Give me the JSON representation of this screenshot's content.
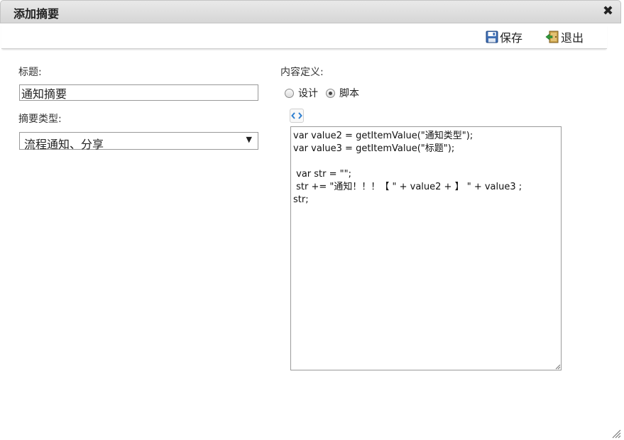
{
  "dialog": {
    "title": "添加摘要",
    "close_glyph": "✖"
  },
  "toolbar": {
    "save_label": "保存",
    "exit_label": "退出"
  },
  "form": {
    "title_label": "标题:",
    "title_value": "通知摘要",
    "summary_type_label": "摘要类型:",
    "summary_type_value": "流程通知、分享",
    "content_label": "内容定义:",
    "mode_options": [
      {
        "label": "设计",
        "checked": false
      },
      {
        "label": "脚本",
        "checked": true
      }
    ],
    "script": "var value2 = getItemValue(\"通知类型\");\nvar value3 = getItemValue(\"标题\");\n\n var str = \"\";\n str += \"通知！！！【 \" + value2 + 】 \" + value3 ;\nstr;"
  },
  "icons": {
    "save": "floppy-disk-icon",
    "exit": "exit-door-icon",
    "code": "code-brackets-icon"
  }
}
